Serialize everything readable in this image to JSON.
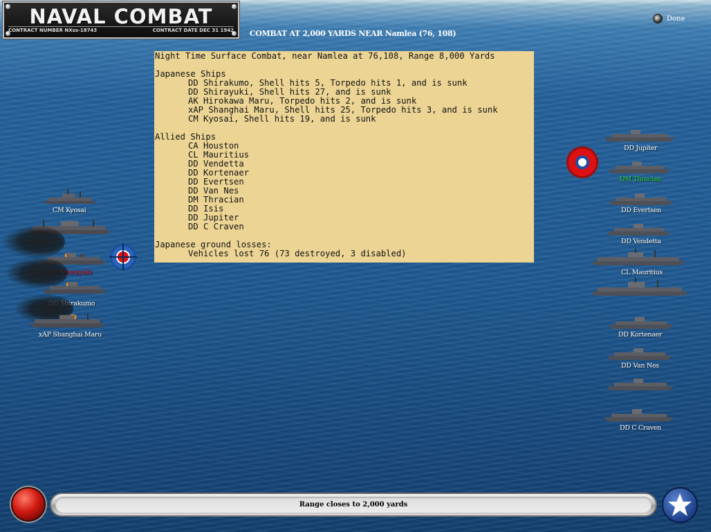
{
  "header": {
    "logo_title": "NAVAL COMBAT",
    "contract_number": "CONTRACT NUMBER   NXss-18743",
    "contract_date": "CONTRACT DATE  DEC 31  1942",
    "combat_title": "COMBAT AT 2,000 YARDS NEAR Namlea (76, 108)",
    "done_label": "Done"
  },
  "report": {
    "lines": [
      {
        "text": "Night Time Surface Combat, near Namlea at 76,108, Range 8,000 Yards",
        "indent": false
      },
      {
        "text": "",
        "indent": false
      },
      {
        "text": "Japanese Ships",
        "indent": false
      },
      {
        "text": "DD Shirakumo, Shell hits 5, Torpedo hits 1, and is sunk",
        "indent": true
      },
      {
        "text": "DD Shirayuki, Shell hits 27, and is sunk",
        "indent": true
      },
      {
        "text": "AK Hirokawa Maru, Torpedo hits 2, and is sunk",
        "indent": true
      },
      {
        "text": "xAP Shanghai Maru, Shell hits 25, Torpedo hits 3, and is sunk",
        "indent": true
      },
      {
        "text": "CM Kyosai, Shell hits 19, and is sunk",
        "indent": true
      },
      {
        "text": "",
        "indent": false
      },
      {
        "text": "Allied Ships",
        "indent": false
      },
      {
        "text": "CA Houston",
        "indent": true
      },
      {
        "text": "CL Mauritius",
        "indent": true
      },
      {
        "text": "DD Vendetta",
        "indent": true
      },
      {
        "text": "DD Kortenaer",
        "indent": true
      },
      {
        "text": "DD Evertsen",
        "indent": true
      },
      {
        "text": "DD Van Nes",
        "indent": true
      },
      {
        "text": "DM Thracian",
        "indent": true
      },
      {
        "text": "DD Isis",
        "indent": true
      },
      {
        "text": "DD Jupiter",
        "indent": true
      },
      {
        "text": "DD C Craven",
        "indent": true
      },
      {
        "text": "",
        "indent": false
      },
      {
        "text": "Japanese ground losses:",
        "indent": false
      },
      {
        "text": "Vehicles lost 76 (73 destroyed, 3 disabled)",
        "indent": true
      }
    ]
  },
  "japanese_labels": {
    "kyosai": "CM Kyosai",
    "shirayuki": "DD Shirayuki",
    "shirakumo": "DD Shirakumo",
    "shanghai": "xAP Shanghai Maru"
  },
  "allied_labels": {
    "jupiter": "DD Jupiter",
    "thracian": "DM Thracian",
    "evertsen": "DD Evertsen",
    "vendetta": "DD Vendetta",
    "mauritius": "CL Mauritius",
    "kortenaer": "DD Kortenaer",
    "vannes": "DD Van Nes",
    "craven": "DD C Craven"
  },
  "status": {
    "message": "Range closes to 2,000 yards"
  },
  "colors": {
    "report_bg": "#ecd594",
    "label_hit_red": "#cc1020",
    "label_active_green": "#2bd42b",
    "label_default": "#ffffff"
  }
}
